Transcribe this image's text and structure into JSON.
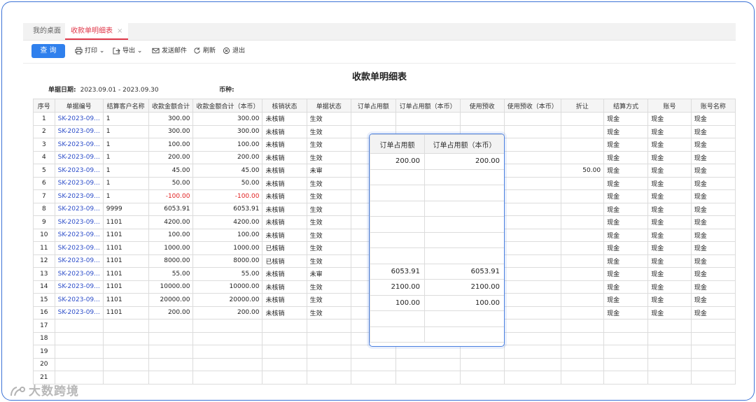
{
  "tabs": [
    {
      "label": "我的桌面"
    },
    {
      "label": "收款单明细表",
      "close": "×"
    }
  ],
  "toolbar": {
    "query": "查 询",
    "print": "打印",
    "export": "导出",
    "email": "发送邮件",
    "refresh": "刷新",
    "exit": "退出"
  },
  "report": {
    "title": "收款单明细表",
    "date_label": "单据日期:",
    "date_value": "2023.09.01 - 2023.09.30",
    "currency_label": "币种:",
    "currency_value": ""
  },
  "table": {
    "columns": [
      "序号",
      "单据编号",
      "结算客户名称",
      "收款金额合计",
      "收款金额合计（本币）",
      "核销状态",
      "单据状态",
      "订单占用额",
      "订单占用额（本币）",
      "使用预收",
      "使用预收（本币）",
      "折让",
      "结算方式",
      "账号",
      "账号名称"
    ],
    "rows": [
      [
        "1",
        "SK-2023-09...",
        "1",
        "300.00",
        "300.00",
        "未核销",
        "生效",
        "",
        "",
        "",
        "",
        "",
        "现金",
        "现金",
        "现金"
      ],
      [
        "2",
        "SK-2023-09...",
        "1",
        "300.00",
        "300.00",
        "未核销",
        "生效",
        "",
        "",
        "",
        "",
        "",
        "现金",
        "现金",
        "现金"
      ],
      [
        "3",
        "SK-2023-09...",
        "1",
        "100.00",
        "100.00",
        "未核销",
        "生效",
        "",
        "",
        "",
        "",
        "",
        "现金",
        "现金",
        "现金"
      ],
      [
        "4",
        "SK-2023-09...",
        "1",
        "200.00",
        "200.00",
        "未核销",
        "生效",
        "",
        "",
        "",
        "",
        "",
        "现金",
        "现金",
        "现金"
      ],
      [
        "5",
        "SK-2023-09...",
        "1",
        "45.00",
        "45.00",
        "未核销",
        "未审",
        "",
        "",
        "",
        "",
        "50.00",
        "现金",
        "现金",
        "现金"
      ],
      [
        "6",
        "SK-2023-09...",
        "1",
        "50.00",
        "50.00",
        "未核销",
        "生效",
        "",
        "",
        "",
        "",
        "",
        "现金",
        "现金",
        "现金"
      ],
      [
        "7",
        "SK-2023-09...",
        "1",
        "-100.00",
        "-100.00",
        "未核销",
        "生效",
        "",
        "",
        "",
        "",
        "",
        "现金",
        "现金",
        "现金"
      ],
      [
        "8",
        "SK-2023-09...",
        "9999",
        "6053.91",
        "6053.91",
        "未核销",
        "生效",
        "",
        "",
        "",
        "",
        "",
        "现金",
        "现金",
        "现金"
      ],
      [
        "9",
        "SK-2023-09...",
        "1101",
        "4200.00",
        "4200.00",
        "未核销",
        "生效",
        "",
        "",
        "",
        "",
        "",
        "现金",
        "现金",
        "现金"
      ],
      [
        "10",
        "SK-2023-09...",
        "1101",
        "100.00",
        "100.00",
        "未核销",
        "生效",
        "",
        "",
        "",
        "",
        "",
        "现金",
        "现金",
        "现金"
      ],
      [
        "11",
        "SK-2023-09...",
        "1101",
        "1000.00",
        "1000.00",
        "已核销",
        "生效",
        "",
        "",
        "",
        "",
        "",
        "现金",
        "现金",
        "现金"
      ],
      [
        "12",
        "SK-2023-09...",
        "1101",
        "8000.00",
        "8000.00",
        "已核销",
        "生效",
        "",
        "",
        "",
        "",
        "",
        "现金",
        "现金",
        "现金"
      ],
      [
        "13",
        "SK-2023-09...",
        "1101",
        "55.00",
        "55.00",
        "未核销",
        "未审",
        "",
        "",
        "",
        "",
        "",
        "现金",
        "现金",
        "现金"
      ],
      [
        "14",
        "SK-2023-09...",
        "1101",
        "10000.00",
        "10000.00",
        "未核销",
        "生效",
        "",
        "",
        "",
        "",
        "",
        "现金",
        "现金",
        "现金"
      ],
      [
        "15",
        "SK-2023-09...",
        "1101",
        "20000.00",
        "20000.00",
        "未核销",
        "生效",
        "",
        "",
        "",
        "",
        "",
        "现金",
        "现金",
        "现金"
      ],
      [
        "16",
        "SK-2023-09...",
        "1101",
        "200.00",
        "200.00",
        "未核销",
        "生效",
        "",
        "",
        "",
        "",
        "",
        "现金",
        "现金",
        "现金"
      ],
      [
        "17",
        "",
        "",
        "",
        "",
        "",
        "",
        "",
        "",
        "",
        "",
        "",
        "",
        "",
        ""
      ],
      [
        "18",
        "",
        "",
        "",
        "",
        "",
        "",
        "",
        "",
        "",
        "",
        "",
        "",
        "",
        ""
      ],
      [
        "19",
        "",
        "",
        "",
        "",
        "",
        "",
        "",
        "",
        "",
        "",
        "",
        "",
        "",
        ""
      ],
      [
        "20",
        "",
        "",
        "",
        "",
        "",
        "",
        "",
        "",
        "",
        "",
        "",
        "",
        "",
        ""
      ],
      [
        "21",
        "",
        "",
        "",
        "",
        "",
        "",
        "",
        "",
        "",
        "",
        "",
        "",
        "",
        ""
      ]
    ]
  },
  "popup": {
    "columns": [
      "订单占用额",
      "订单占用额（本币）"
    ],
    "rows": [
      [
        "200.00",
        "200.00"
      ],
      [
        "",
        ""
      ],
      [
        "",
        ""
      ],
      [
        "",
        ""
      ],
      [
        "",
        ""
      ],
      [
        "",
        ""
      ],
      [
        "",
        ""
      ],
      [
        "6053.91",
        "6053.91"
      ],
      [
        "2100.00",
        "2100.00"
      ],
      [
        "100.00",
        "100.00"
      ],
      [
        "",
        ""
      ],
      [
        "",
        ""
      ]
    ]
  },
  "colors": {
    "accent": "#2f80ed",
    "tab_active": "#e0384a",
    "link": "#2c4dc9",
    "negative": "#e02020",
    "frame": "#3d73d6"
  },
  "watermark": "大数跨境"
}
